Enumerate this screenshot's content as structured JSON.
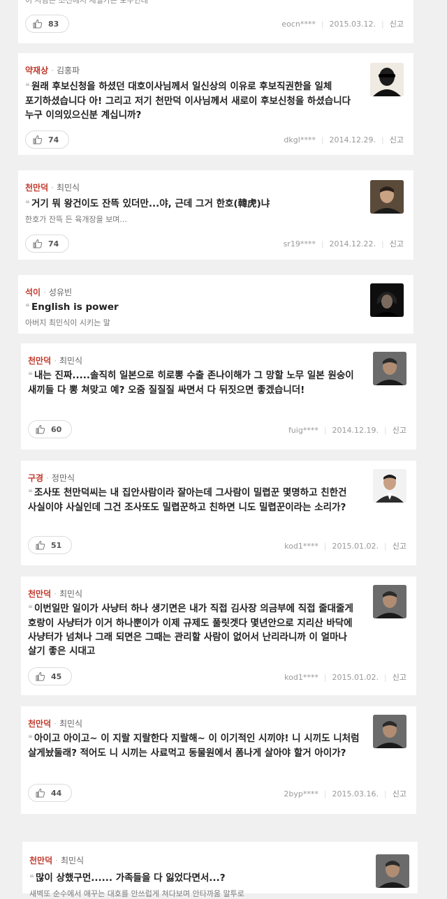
{
  "top_partial": {
    "text": "이 사람은 조선에서 제일가는 포수인데",
    "likes": "83",
    "user": "eocn****",
    "date": "2015.03.12.",
    "report": "신고"
  },
  "comments": [
    {
      "character": "약재상",
      "actor": "김홍파",
      "text": "원래 후보신청을 하셨던 대호이사님께서 일신상의 이유로 후보직권한을 일체 포기하셨습니다 아! 그리고 저기 천만덕 이사님께서 새로이 후보신청을 하셨습니다 누구 이의있으신분 계십니까?",
      "sub": "",
      "likes": "74",
      "user": "dkgl****",
      "date": "2014.12.29.",
      "report": "신고"
    },
    {
      "character": "천만덕",
      "actor": "최민식",
      "text": "거기 뭐 왕건이도 잔뜩 있더만...야, 근데 그거 한호(韓虎)냐",
      "sub": "한호가 잔뜩 든 육개장을 보며...",
      "likes": "74",
      "user": "sr19****",
      "date": "2014.12.22.",
      "report": "신고"
    },
    {
      "character": "석이",
      "actor": "성유빈",
      "text": "English is power",
      "sub": "아버지 최민식이 시키는 말"
    },
    {
      "character": "천만덕",
      "actor": "최민식",
      "text": "내는 진짜.....솔직히 일본으로 히로뽕 수출 존나이해가 그 망할 노무 일본 원숭이 새끼들 다 뽕 쳐맞고 예? 오줌 질질질 싸면서 다 뒤짓으면 좋겠습니더!",
      "sub": "",
      "likes": "60",
      "user": "fuig****",
      "date": "2014.12.19.",
      "report": "신고"
    },
    {
      "character": "구경",
      "actor": "정만식",
      "text": "조사또 천만덕씨는 내 집안사람이라 잘아는데 그사람이 밀렵꾼 몇명하고 친한건 사실이야 사실인데 그건 조사또도 밀렵꾼하고 친하면 니도 밀렵꾼이라는 소리가?",
      "sub": "",
      "likes": "51",
      "user": "kod1****",
      "date": "2015.01.02.",
      "report": "신고"
    },
    {
      "character": "천만덕",
      "actor": "최민식",
      "text": "이번일만 일이가 사냥터 하나 생기면은 내가 직접 김사장 의금부에 직접 줄대줄게 호랑이 사냥터가 이거 하나뿐이가 이제 규제도 풀릿겟다 몇년안으로 지리산 바닥에 사냥터가 넘쳐나 그래 되면은 그때는 관리할 사람이 없어서 난리라니까 이 얼마나 살기 좋은 시대고",
      "sub": "",
      "likes": "45",
      "user": "kod1****",
      "date": "2015.01.02.",
      "report": "신고"
    },
    {
      "character": "천만덕",
      "actor": "최민식",
      "text": "아이고 아이고~ 이 지랄 지랄한다 지랄해~ 이 이기적인 시끼야! 니 시끼도 니처럼 살게놨둘래? 적어도 니 시끼는 사료먹고 동물원에서 폼나게 살아야 할거 아이가?",
      "sub": "",
      "likes": "44",
      "user": "2byp****",
      "date": "2015.03.16.",
      "report": "신고"
    },
    {
      "character": "천만덕",
      "actor": "최민식",
      "text": "많이 상했구먼...... 가족들을 다 잃었다면서...?",
      "sub": "새벽또 순수에서 애꾸는 대호를 안쓰럽게 쳐다보며 안타까움 말투로"
    }
  ]
}
